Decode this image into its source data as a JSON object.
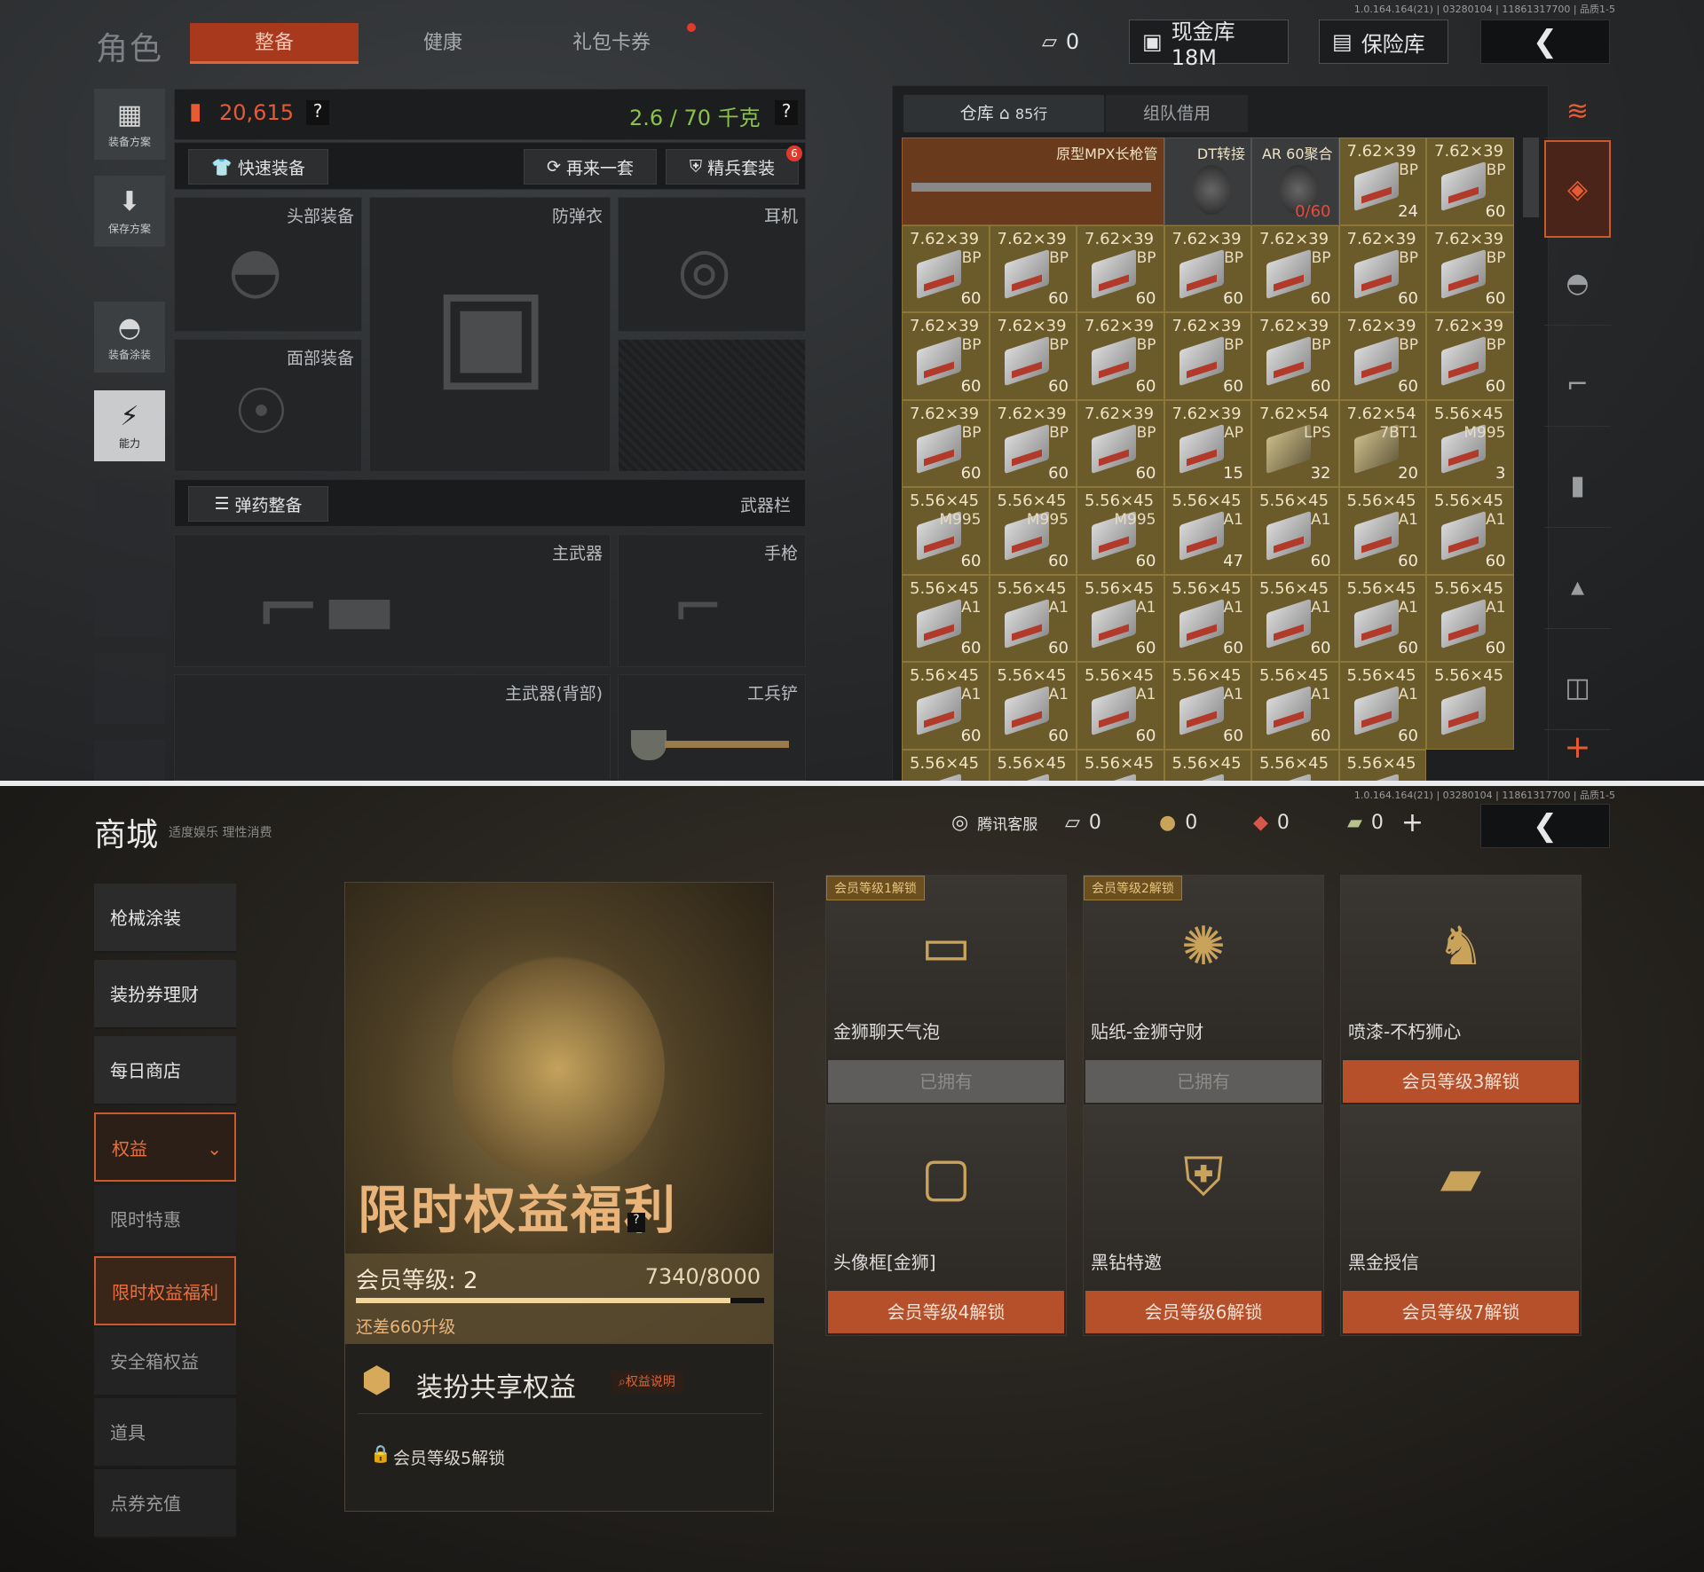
{
  "screen1": {
    "version": "1.0.164.164(21) | 03280104 | 11861317700 | 品质1-5",
    "title": "角色",
    "tabs": [
      "整备",
      "健康",
      "礼包卡券"
    ],
    "resources": {
      "tickets": "0",
      "cash_vault": "现金库 18M",
      "safe_vault": "保险库"
    },
    "side_buttons": [
      "装备方案",
      "保存方案",
      "装备涂装",
      "能力"
    ],
    "equip": {
      "value": "20,615",
      "weight": "2.6 / 70 千克",
      "help": "?",
      "quick": "快速装备",
      "again": "再来一套",
      "elite": "精兵套装",
      "elite_badge": "6",
      "slots": {
        "head": "头部装备",
        "armor": "防弹衣",
        "ear": "耳机",
        "face": "面部装备"
      },
      "ammo_btn": "弹药整备",
      "weapon_bar": "武器栏",
      "primary": "主武器",
      "pistol": "手枪",
      "primary_back": "主武器(背部)",
      "shovel": "工兵铲"
    },
    "inventory": {
      "tab_storage": "仓库",
      "storage_count": "85行",
      "tab_team": "组队借用",
      "items": [
        {
          "name": "原型MPX长枪管",
          "kind": "wide"
        },
        {
          "name": "DT转接",
          "kind": "part"
        },
        {
          "name": "AR 60聚合",
          "kind": "part",
          "count": "0/60"
        },
        {
          "cal": "7.62×39",
          "type": "BP",
          "count": "24"
        },
        {
          "cal": "7.62×39",
          "type": "BP",
          "count": "60"
        },
        {
          "cal": "7.62×39",
          "type": "BP",
          "count": "60"
        },
        {
          "cal": "7.62×39",
          "type": "BP",
          "count": "60"
        },
        {
          "cal": "7.62×39",
          "type": "BP",
          "count": "60"
        },
        {
          "cal": "7.62×39",
          "type": "BP",
          "count": "60"
        },
        {
          "cal": "7.62×39",
          "type": "BP",
          "count": "60"
        },
        {
          "cal": "7.62×39",
          "type": "BP",
          "count": "60"
        },
        {
          "cal": "7.62×39",
          "type": "BP",
          "count": "60"
        },
        {
          "cal": "7.62×39",
          "type": "BP",
          "count": "60"
        },
        {
          "cal": "7.62×39",
          "type": "BP",
          "count": "60"
        },
        {
          "cal": "7.62×39",
          "type": "BP",
          "count": "60"
        },
        {
          "cal": "7.62×39",
          "type": "BP",
          "count": "60"
        },
        {
          "cal": "7.62×39",
          "type": "BP",
          "count": "60"
        },
        {
          "cal": "7.62×39",
          "type": "BP",
          "count": "60"
        },
        {
          "cal": "7.62×39",
          "type": "BP",
          "count": "60"
        },
        {
          "cal": "7.62×39",
          "type": "BP",
          "count": "60"
        },
        {
          "cal": "7.62×39",
          "type": "BP",
          "count": "60"
        },
        {
          "cal": "7.62×39",
          "type": "BP",
          "count": "60"
        },
        {
          "cal": "7.62×39",
          "type": "AP",
          "count": "15"
        },
        {
          "cal": "7.62×54",
          "type": "LPS",
          "count": "32"
        },
        {
          "cal": "7.62×54",
          "type": "7BT1",
          "count": "20"
        },
        {
          "cal": "5.56×45",
          "type": "M995",
          "count": "3"
        },
        {
          "cal": "5.56×45",
          "type": "M995",
          "count": "60"
        },
        {
          "cal": "5.56×45",
          "type": "M995",
          "count": "60"
        },
        {
          "cal": "5.56×45",
          "type": "M995",
          "count": "60"
        },
        {
          "cal": "5.56×45",
          "type": "A1",
          "count": "47"
        },
        {
          "cal": "5.56×45",
          "type": "A1",
          "count": "60"
        },
        {
          "cal": "5.56×45",
          "type": "A1",
          "count": "60"
        },
        {
          "cal": "5.56×45",
          "type": "A1",
          "count": "60"
        },
        {
          "cal": "5.56×45",
          "type": "A1",
          "count": "60"
        },
        {
          "cal": "5.56×45",
          "type": "A1",
          "count": "60"
        },
        {
          "cal": "5.56×45",
          "type": "A1",
          "count": "60"
        },
        {
          "cal": "5.56×45",
          "type": "A1",
          "count": "60"
        },
        {
          "cal": "5.56×45",
          "type": "A1",
          "count": "60"
        },
        {
          "cal": "5.56×45",
          "type": "A1",
          "count": "60"
        },
        {
          "cal": "5.56×45",
          "type": "A1",
          "count": "60"
        },
        {
          "cal": "5.56×45",
          "type": "A1",
          "count": "60"
        },
        {
          "cal": "5.56×45",
          "type": "A1",
          "count": "60"
        },
        {
          "cal": "5.56×45",
          "type": "A1",
          "count": "60"
        },
        {
          "cal": "5.56×45",
          "type": "A1",
          "count": "60"
        },
        {
          "cal": "5.56×45",
          "type": "A1",
          "count": "60"
        },
        {
          "cal": "5.56×45",
          "type": "A1",
          "count": "60"
        },
        {
          "cal": "5.56×45",
          "type": "",
          "count": ""
        },
        {
          "cal": "5.56×45",
          "type": "",
          "count": ""
        },
        {
          "cal": "5.56×45",
          "type": "",
          "count": ""
        },
        {
          "cal": "5.56×45",
          "type": "",
          "count": ""
        },
        {
          "cal": "5.56×45",
          "type": "",
          "count": ""
        },
        {
          "cal": "5.56×45",
          "type": "",
          "count": ""
        },
        {
          "cal": "5.56×45",
          "type": "",
          "count": ""
        }
      ]
    }
  },
  "screen2": {
    "version": "1.0.164.164(21) | 03280104 | 11861317700 | 品质1-5",
    "title": "商城",
    "subtitle": "适度娱乐 理性消费",
    "support": "腾讯客服",
    "currencies": [
      "0",
      "0",
      "0",
      "0"
    ],
    "menu": [
      "枪械涂装",
      "装扮券理财",
      "每日商店",
      "权益",
      "限时特惠",
      "限时权益福利",
      "安全箱权益",
      "道具",
      "点券充值"
    ],
    "banner": {
      "headline": "限时权益福利",
      "level_label": "会员等级: 2",
      "progress_text": "7340/8000",
      "progress": 0.9175,
      "remaining": "还差660升级",
      "share_title": "装扮共享权益",
      "share_link": "权益说明",
      "share_lock": "会员等级5解锁"
    },
    "items": [
      {
        "tag": "会员等级1解锁",
        "name": "金狮聊天气泡",
        "action": "已拥有",
        "state": "owned",
        "icon": "chat-bubble-icon"
      },
      {
        "tag": "会员等级2解锁",
        "name": "贴纸-金狮守财",
        "action": "已拥有",
        "state": "owned",
        "icon": "sticker-icon"
      },
      {
        "tag": "",
        "name": "喷漆-不朽狮心",
        "action": "会员等级3解锁",
        "state": "lock",
        "icon": "spray-icon"
      },
      {
        "tag": "",
        "name": "头像框[金狮]",
        "action": "会员等级4解锁",
        "state": "lock",
        "icon": "avatar-frame-icon"
      },
      {
        "tag": "",
        "name": "黑钻特邀",
        "action": "会员等级6解锁",
        "state": "lock",
        "icon": "badge-icon"
      },
      {
        "tag": "",
        "name": "黑金授信",
        "action": "会员等级7解锁",
        "state": "lock",
        "icon": "card-icon"
      }
    ]
  }
}
